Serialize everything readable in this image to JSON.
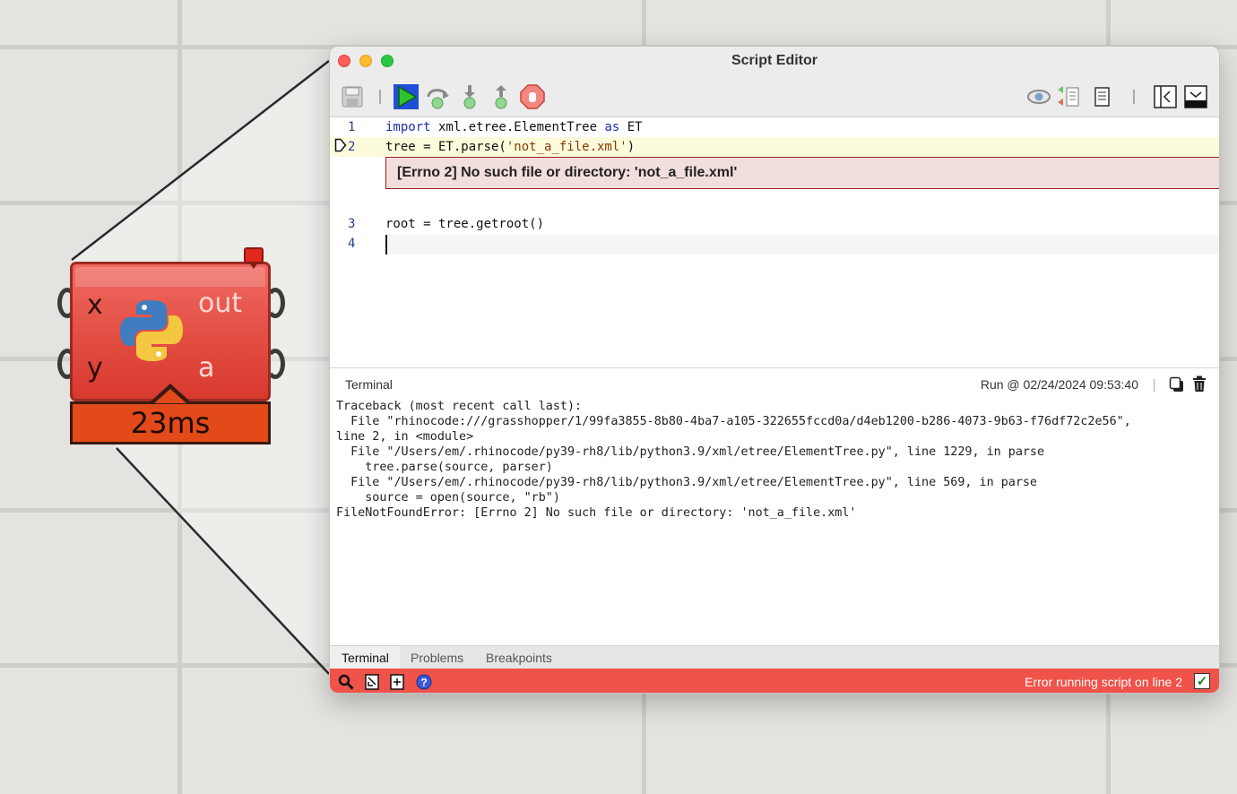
{
  "canvas": {
    "component": {
      "inputs": [
        "x",
        "y"
      ],
      "outputs": [
        "out",
        "a"
      ],
      "timer": "23ms"
    }
  },
  "window": {
    "title": "Script Editor",
    "toolbar": {
      "icons": [
        "save-icon",
        "run-icon",
        "step-over-icon",
        "step-into-icon",
        "step-out-icon",
        "stop-icon",
        "watch-icon",
        "compare-icon",
        "notes-icon",
        "collapse-panel-icon",
        "minimize-panel-icon"
      ]
    },
    "editor": {
      "lines": [
        {
          "number": "1",
          "kw1": "import",
          "mid": " xml.etree.ElementTree ",
          "kw2": "as",
          "tail": " ET"
        },
        {
          "number": "2",
          "pre": "tree = ET.parse(",
          "str": "'not_a_file.xml'",
          "post": ")"
        },
        {
          "number": "3",
          "text": "root = tree.getroot()"
        },
        {
          "number": "4",
          "text": ""
        }
      ],
      "error_message": "[Errno 2] No such file or directory: 'not_a_file.xml'"
    },
    "terminal": {
      "title": "Terminal",
      "run_info": "Run @ 02/24/2024 09:53:40",
      "output": [
        "Traceback (most recent call last):",
        "  File \"rhinocode:///grasshopper/1/99fa3855-8b80-4ba7-a105-322655fccd0a/d4eb1200-b286-4073-9b63-f76df72c2e56\",",
        "line 2, in <module>",
        "  File \"/Users/em/.rhinocode/py39-rh8/lib/python3.9/xml/etree/ElementTree.py\", line 1229, in parse",
        "    tree.parse(source, parser)",
        "  File \"/Users/em/.rhinocode/py39-rh8/lib/python3.9/xml/etree/ElementTree.py\", line 569, in parse",
        "    source = open(source, \"rb\")",
        "FileNotFoundError: [Errno 2] No such file or directory: 'not_a_file.xml'"
      ]
    },
    "tabs": [
      "Terminal",
      "Problems",
      "Breakpoints"
    ],
    "status": {
      "message": "Error running script on line 2",
      "check": "✓",
      "color": "#f0534a"
    }
  }
}
